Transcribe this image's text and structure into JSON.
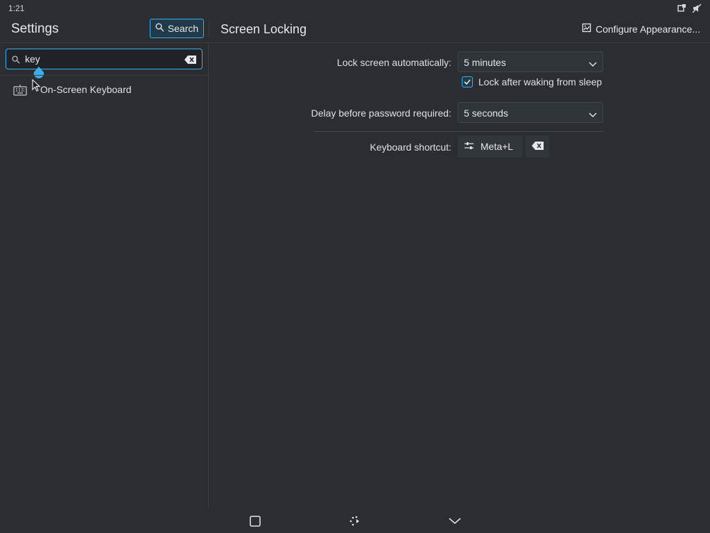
{
  "status": {
    "time": "1:21",
    "icons": [
      "notification-icon",
      "volume-muted-icon"
    ]
  },
  "header": {
    "app_title": "Settings",
    "search_label": "Search",
    "page_title": "Screen Locking",
    "configure_label": "Configure Appearance..."
  },
  "sidebar": {
    "search": {
      "value": "key",
      "placeholder": ""
    },
    "results": [
      {
        "label": "On-Screen Keyboard",
        "icon": "keyboard-icon"
      }
    ]
  },
  "form": {
    "lock_auto_label": "Lock screen automatically:",
    "lock_auto_value": "5 minutes",
    "lock_after_sleep_label": "Lock after waking from sleep",
    "lock_after_sleep_checked": true,
    "delay_label": "Delay before password required:",
    "delay_value": "5 seconds",
    "shortcut_label": "Keyboard shortcut:",
    "shortcut_value": "Meta+L"
  },
  "navbar": {
    "icons": [
      "task-switcher-icon",
      "home-icon",
      "hide-keyboard-icon"
    ]
  },
  "colors": {
    "accent": "#3daee9",
    "background": "#2a2e32"
  }
}
